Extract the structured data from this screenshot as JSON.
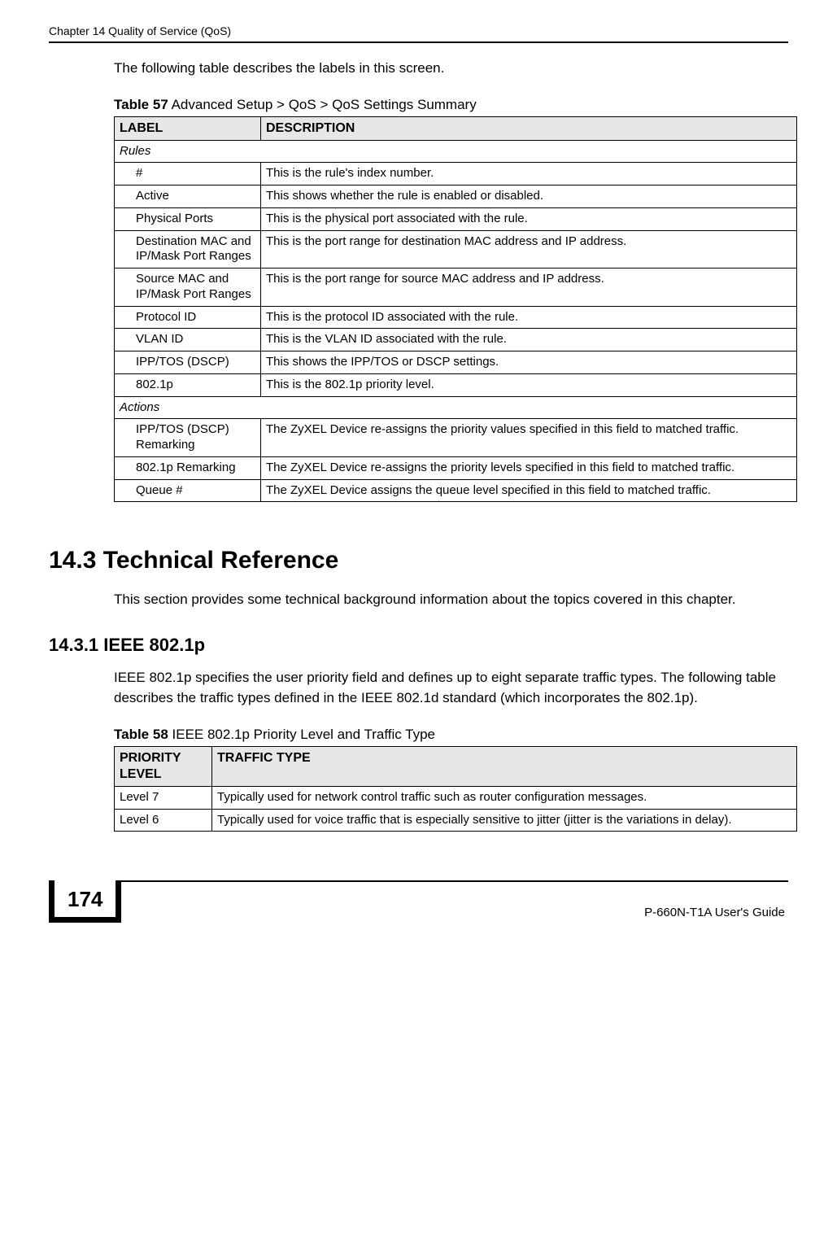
{
  "header": {
    "chapter": "Chapter 14 Quality of Service (QoS)"
  },
  "intro_text": "The following table describes the labels in this screen.",
  "table57": {
    "caption_bold": "Table 57",
    "caption_rest": "   Advanced Setup > QoS > QoS Settings Summary",
    "head_label": "LABEL",
    "head_desc": "DESCRIPTION",
    "rules_header": "Rules",
    "rows_rules": [
      {
        "label": "#",
        "desc": "This is the rule's index number."
      },
      {
        "label": "Active",
        "desc": "This shows whether the rule is enabled or disabled."
      },
      {
        "label": "Physical Ports",
        "desc": "This is the physical port associated with the rule."
      },
      {
        "label": "Destination MAC and IP/Mask Port Ranges",
        "desc": "This is the port range for destination MAC address and IP address."
      },
      {
        "label": "Source MAC and IP/Mask Port Ranges",
        "desc": "This is the port range for source MAC address and IP address."
      },
      {
        "label": "Protocol ID",
        "desc": "This is the protocol ID associated with the rule."
      },
      {
        "label": "VLAN ID",
        "desc": "This is the VLAN ID associated with the rule."
      },
      {
        "label": "IPP/TOS (DSCP)",
        "desc": "This shows the IPP/TOS or DSCP settings."
      },
      {
        "label": "802.1p",
        "desc": "This is the 802.1p priority level."
      }
    ],
    "actions_header": "Actions",
    "rows_actions": [
      {
        "label": "IPP/TOS (DSCP) Remarking",
        "desc": "The ZyXEL Device re-assigns the priority values specified in this field to matched traffic."
      },
      {
        "label": "802.1p Remarking",
        "desc": "The ZyXEL Device re-assigns the priority levels specified in this field to matched traffic."
      },
      {
        "label": "Queue #",
        "desc": "The ZyXEL Device assigns the queue level specified in this field to matched traffic."
      }
    ]
  },
  "section_14_3": {
    "heading": "14.3  Technical Reference",
    "text": "This section provides some technical background information about the topics covered in this chapter."
  },
  "section_14_3_1": {
    "heading": "14.3.1  IEEE 802.1p",
    "text": "IEEE 802.1p specifies the user priority field and defines up to eight separate traffic types. The following table describes the traffic types defined in the IEEE 802.1d standard (which incorporates the 802.1p)."
  },
  "table58": {
    "caption_bold": "Table 58",
    "caption_rest": "   IEEE 802.1p Priority Level and Traffic Type",
    "head_level": "PRIORITY LEVEL",
    "head_type": "TRAFFIC TYPE",
    "rows": [
      {
        "level": "Level 7",
        "type": "Typically used for network control traffic such as router configuration messages."
      },
      {
        "level": "Level 6",
        "type": "Typically used for voice traffic that is especially sensitive to jitter (jitter is the variations in delay)."
      }
    ]
  },
  "footer": {
    "page_number": "174",
    "guide": "P-660N-T1A User's Guide"
  }
}
